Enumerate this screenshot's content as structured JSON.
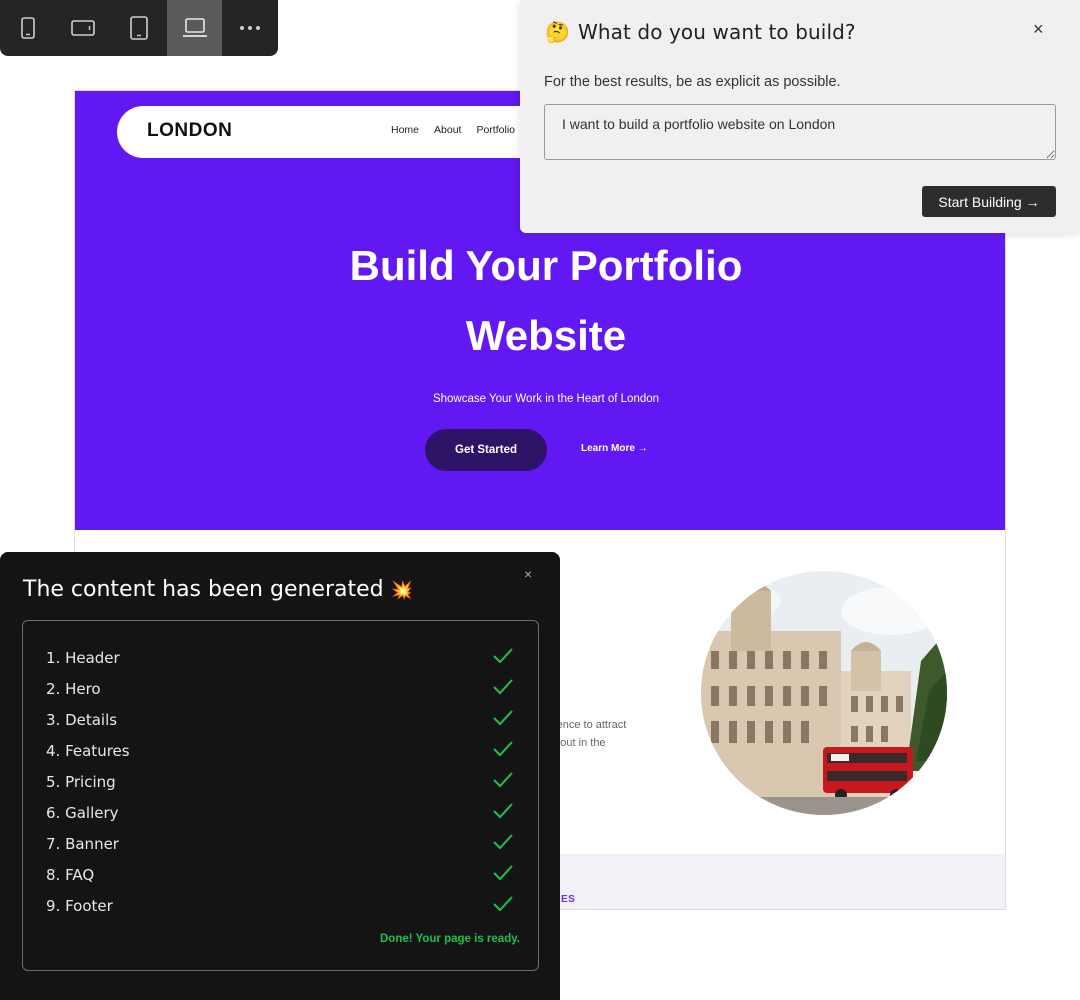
{
  "toolbar": {
    "devices": [
      {
        "name": "mobile-portrait",
        "icon": "phone-icon",
        "active": false
      },
      {
        "name": "mobile-landscape",
        "icon": "phone-landscape-icon",
        "active": false
      },
      {
        "name": "tablet",
        "icon": "tablet-icon",
        "active": false
      },
      {
        "name": "desktop",
        "icon": "laptop-icon",
        "active": true
      }
    ],
    "more_label": "···"
  },
  "site": {
    "logo": "LONDON",
    "nav": [
      "Home",
      "About",
      "Portfolio"
    ],
    "hero_title_line1": "Build Your Portfolio",
    "hero_title_line2": "Website",
    "hero_subtitle": "Showcase Your Work in the Heart of London",
    "cta_primary": "Get Started",
    "cta_secondary": "Learn More →",
    "about_text_line1": "esence to attract",
    "about_text_line2": "nd out in the",
    "band_label": "ES",
    "colors": {
      "hero_bg": "#6118f2",
      "cta_bg": "#2d1467",
      "band_bg": "#f1f2f7"
    }
  },
  "prompt": {
    "emoji": "🤔",
    "title": "What do you want to build?",
    "close": "×",
    "subtitle": "For the best results, be as explicit as possible.",
    "input_value": "I want to build a portfolio website on London",
    "button": "Start Building →"
  },
  "generation": {
    "title": "The content has been generated",
    "emoji": "💥",
    "close": "×",
    "sections": [
      "1. Header",
      "2. Hero",
      "3. Details",
      "4. Features",
      "5. Pricing",
      "6. Gallery",
      "7. Banner",
      "8. FAQ",
      "9. Footer"
    ],
    "done": "Done! Your page is ready.",
    "check_color": "#21c04a"
  }
}
